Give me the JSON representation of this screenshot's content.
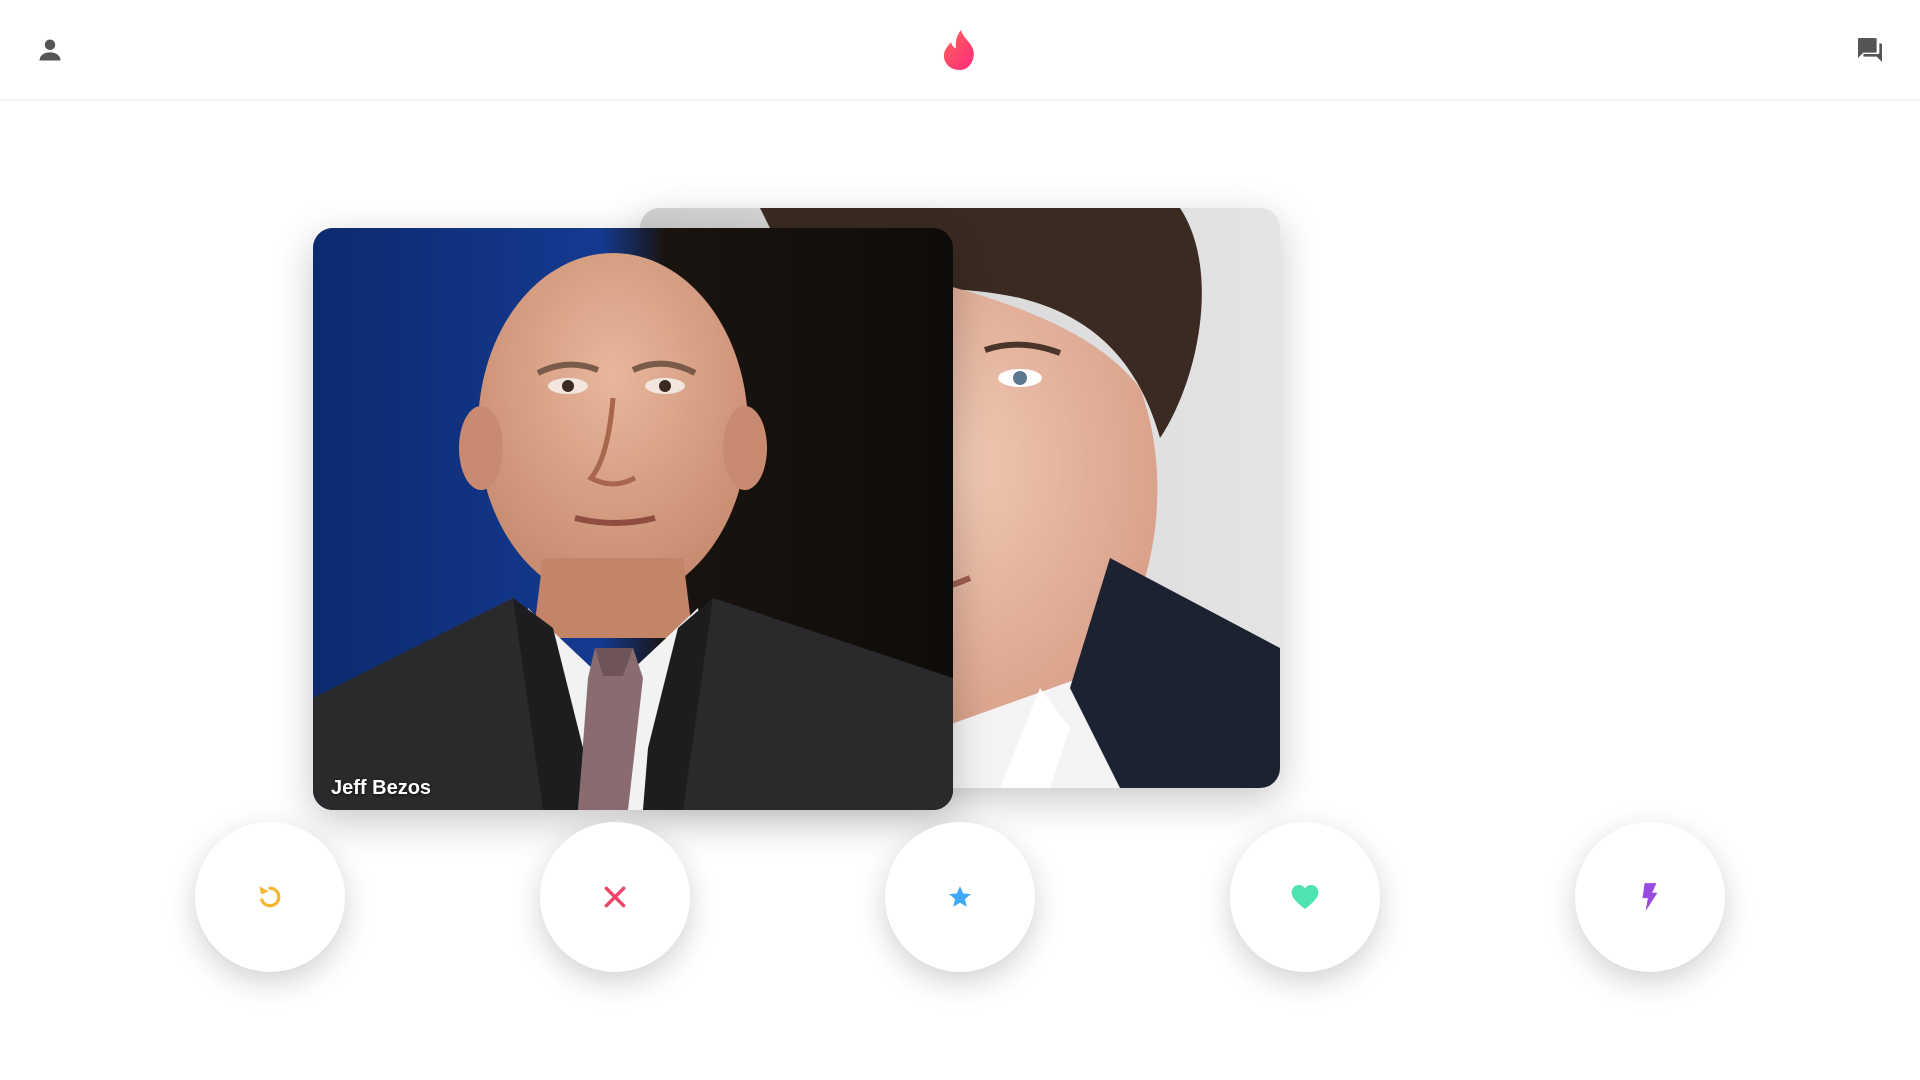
{
  "header": {
    "profile_icon": "person-icon",
    "logo_icon": "flame-logo-icon",
    "chat_icon": "chat-bubbles-icon"
  },
  "cards": {
    "back": {
      "name": ""
    },
    "front": {
      "name": "Jeff Bezos"
    }
  },
  "actions": [
    {
      "id": "rewind",
      "icon": "rewind-icon",
      "color": "#f5b731"
    },
    {
      "id": "nope",
      "icon": "close-icon",
      "color": "#f0436a"
    },
    {
      "id": "superlike",
      "icon": "star-icon",
      "color": "#3fa9f5"
    },
    {
      "id": "like",
      "icon": "heart-icon",
      "color": "#4fe3b1"
    },
    {
      "id": "boost",
      "icon": "lightning-icon",
      "color": "#9b4ae0"
    }
  ],
  "colors": {
    "brand_gradient_start": "#fd297b",
    "brand_gradient_end": "#ff655b",
    "icon_gray": "#555555"
  }
}
